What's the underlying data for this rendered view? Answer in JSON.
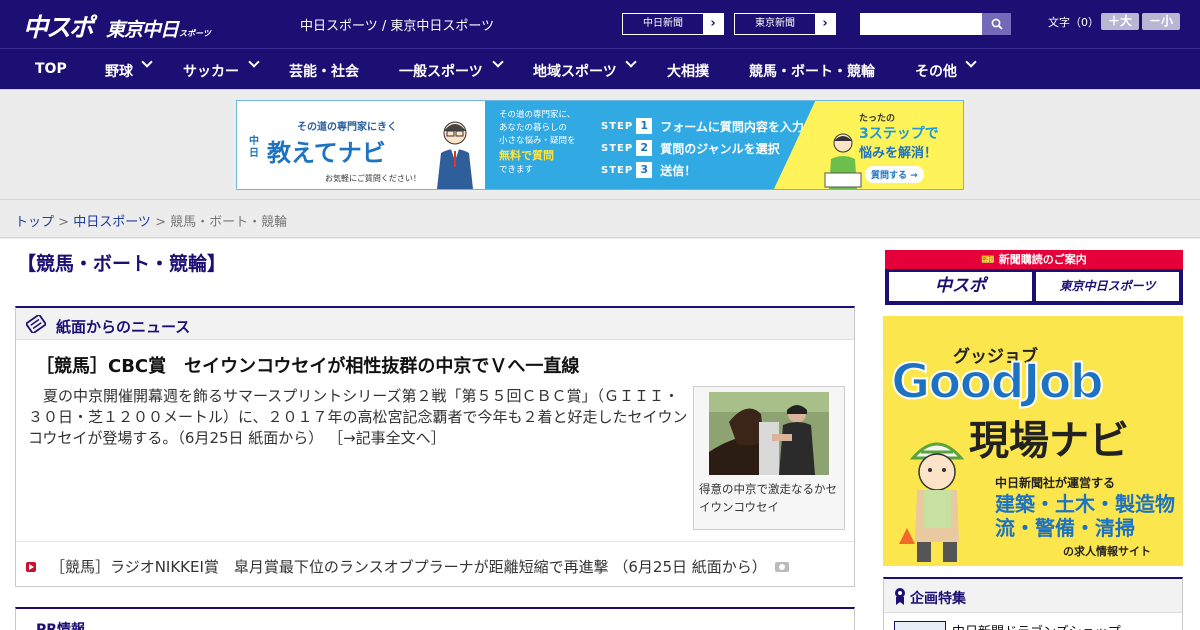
{
  "header": {
    "logo_main": "中スポ",
    "logo_tokyo": "東京中日",
    "logo_sports": "スポーツ",
    "site_title": "中日スポーツ / 東京中日スポーツ",
    "links": [
      "中日新聞",
      "東京新聞"
    ],
    "search": {
      "placeholder": "",
      "icon": "search-icon"
    },
    "font_size": {
      "label": "文字（0）",
      "bigger": "＋大",
      "smaller": "－小"
    }
  },
  "nav": {
    "items": [
      {
        "label": "TOP",
        "dropdown": false
      },
      {
        "label": "野球",
        "dropdown": true
      },
      {
        "label": "サッカー",
        "dropdown": true
      },
      {
        "label": "芸能・社会",
        "dropdown": false
      },
      {
        "label": "一般スポーツ",
        "dropdown": true
      },
      {
        "label": "地域スポーツ",
        "dropdown": true
      },
      {
        "label": "大相撲",
        "dropdown": false
      },
      {
        "label": "競馬・ボート・競輪",
        "dropdown": false
      },
      {
        "label": "その他",
        "dropdown": true
      }
    ]
  },
  "ad_banner": {
    "small": "その道の専門家にきく",
    "brand_prefix": "中日",
    "title": "教えてナビ",
    "note": "お気軽にご質問ください！",
    "desc": [
      "その道の専門家に、",
      "あなたの暮らしの",
      "小さな悩み・疑問を",
      "無料で質問",
      "できます"
    ],
    "steps": [
      {
        "num": "1",
        "text": "フォームに質問内容を入力"
      },
      {
        "num": "2",
        "text": "質問のジャンルを選択"
      },
      {
        "num": "3",
        "text": "送信！"
      }
    ],
    "step_word": "STEP",
    "right_1": "たったの",
    "right_2": "3ステップで",
    "right_3": "悩みを解消！",
    "cta": "質問する →"
  },
  "breadcrumb": {
    "items": [
      "トップ",
      "中日スポーツ"
    ],
    "current": "競馬・ボート・競輪",
    "separator": " > "
  },
  "main": {
    "page_title": "【競馬・ボート・競輪】",
    "news_section": {
      "title": "紙面からのニュース",
      "headline": "［競馬］CBC賞　セイウンコウセイが相性抜群の中京でＶへ一直線",
      "body": "夏の中京開催開幕週を飾るサマースプリントシリーズ第２戦「第５５回ＣＢＣ賞」（ＧＩＩＩ・３０日・芝１２００メートル）に、２０１７年の高松宮記念覇者で今年も２着と好走したセイウンコウセイが登場する。（6月25日 紙面から）",
      "more": "［→記事全文へ］",
      "photo_caption": "得意の中京で激走なるかセイウンコウセイ",
      "sub_item": "［競馬］ラジオNIKKEI賞　皐月賞最下位のランスオブプラーナが距離短縮で再進撃 （6月25日 紙面から）"
    },
    "pr_title": "PR情報"
  },
  "sidebar": {
    "subscribe_head": "新聞購読のご案内",
    "subscribe_buttons": [
      "中スポ",
      "東京中日スポーツ"
    ],
    "goodjob": {
      "small": "グッジョブ",
      "title": "GoodJob",
      "navi": "現場ナビ",
      "operated": "中日新聞社が運営する",
      "jobs": "建築・土木・製造物流・警備・清掃",
      "site": "の求人情報サイト"
    },
    "plan_title": "企画特集",
    "plan_item": "中日新聞ドラゴンズショップ"
  },
  "colors": {
    "brand_navy": "#1c0f74",
    "accent_red": "#e60039",
    "goodjob_yellow": "#fce64d",
    "banner_blue": "#31a9e3"
  }
}
